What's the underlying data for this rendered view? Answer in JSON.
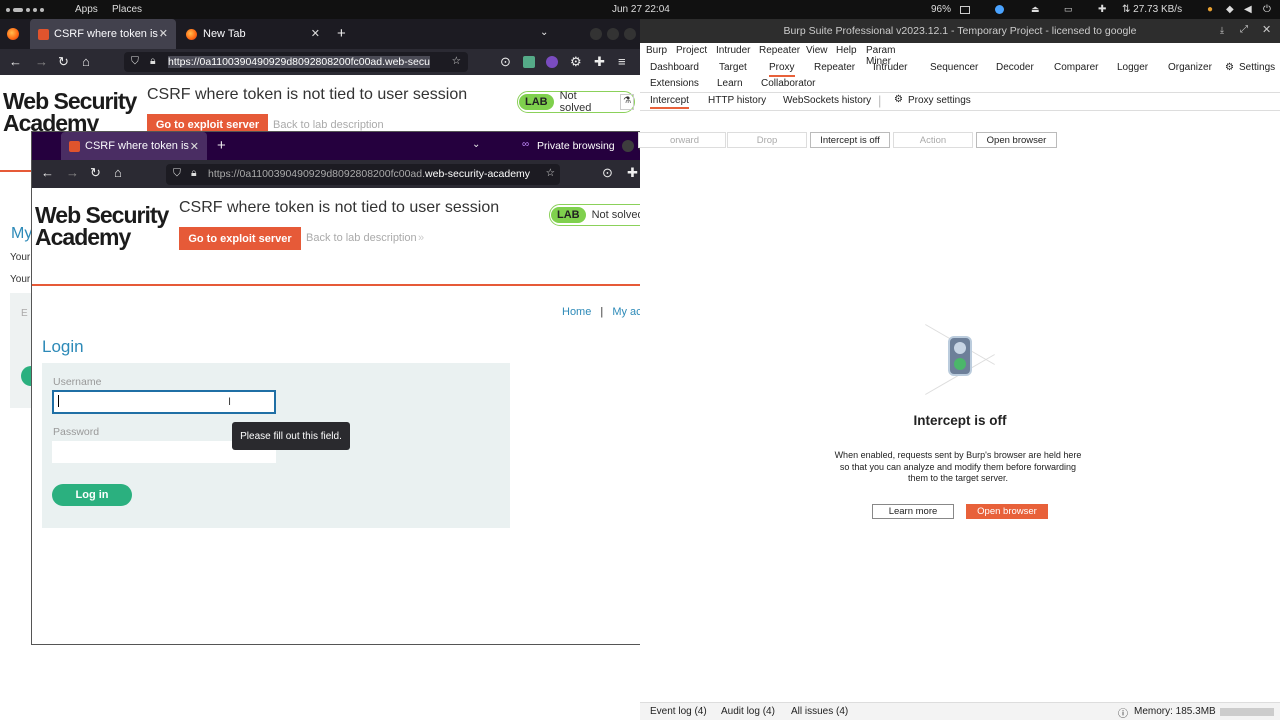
{
  "system": {
    "apps": "Apps",
    "places": "Places",
    "datetime": "Jun 27  22:04",
    "battery": "96%",
    "network_speed": "⇅ 27.73 KB/s"
  },
  "left_browser": {
    "tabs": [
      {
        "label": "CSRF where token is not t"
      },
      {
        "label": "New Tab"
      }
    ],
    "url": "https://0a1100390490929d8092808200fc00ad.web-secu"
  },
  "lab_page": {
    "logo_line1": "Web Security",
    "logo_line2": "Academy",
    "title": "CSRF where token is not tied to user session",
    "exploit_button": "Go to exploit server",
    "back_link": "Back to lab description",
    "back_arrow": "»",
    "lab_badge": "LAB",
    "status": "Not solved",
    "partial_my": "My",
    "partial_your1": "Your",
    "partial_your2": "Your",
    "partial_e": "E"
  },
  "private_browser": {
    "tab_label": "CSRF where token is not t",
    "private_label": "Private browsing",
    "url_prefix": "https://0a1100390490929d8092808200fc00ad.",
    "url_domain": "web-security-academy",
    "nav_home": "Home",
    "nav_sep": "|",
    "nav_account": "My account",
    "login_heading": "Login",
    "username_label": "Username",
    "username_value": "",
    "password_label": "Password",
    "tooltip": "Please fill out this field.",
    "login_button": "Log in"
  },
  "burp": {
    "window_title": "Burp Suite Professional v2023.12.1 - Temporary Project - licensed to google",
    "menu": [
      "Burp",
      "Project",
      "Intruder",
      "Repeater",
      "View",
      "Help",
      "Param Miner"
    ],
    "tabs_row1": [
      "Dashboard",
      "Target",
      "Proxy",
      "Repeater",
      "Intruder",
      "Sequencer",
      "Decoder",
      "Comparer",
      "Logger",
      "Organizer"
    ],
    "settings": "Settings",
    "tabs_row2": [
      "Extensions",
      "Learn",
      "Collaborator"
    ],
    "subtabs": [
      "Intercept",
      "HTTP history",
      "WebSockets history"
    ],
    "proxy_settings": "Proxy settings",
    "toolbar": {
      "forward": "orward",
      "drop": "Drop",
      "intercept": "Intercept is off",
      "action": "Action",
      "open_browser": "Open browser"
    },
    "empty_title": "Intercept is off",
    "empty_text1": "When enabled, requests sent by Burp's browser are held here",
    "empty_text2": "so that you can analyze and modify them before forwarding",
    "empty_text3": "them to the target server.",
    "learn_more": "Learn more",
    "open_browser_btn": "Open browser",
    "status": {
      "event_log": "Event log (4)",
      "audit_log": "Audit log (4)",
      "all_issues": "All issues (4)",
      "memory": "Memory: 185.3MB"
    },
    "accent": "#e8613a"
  }
}
